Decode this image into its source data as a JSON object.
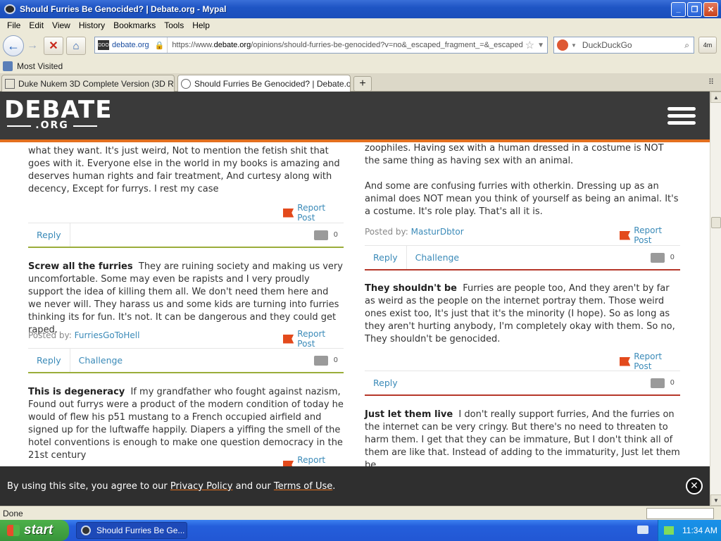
{
  "window": {
    "title": "Should Furries Be Genocided? | Debate.org - Mypal"
  },
  "menu": [
    "File",
    "Edit",
    "View",
    "History",
    "Bookmarks",
    "Tools",
    "Help"
  ],
  "nav": {
    "site_chip": "debate.org",
    "site_fav": "DDO",
    "url_prefix": "https://www.",
    "url_domain": "debate.org",
    "url_rest": "/opinions/should-furries-be-genocided?v=no&_escaped_fragment_=&_escaped_",
    "search_placeholder": "DuckDuckGo",
    "extra_button": "4m"
  },
  "bookmarks": {
    "most_visited": "Most Visited"
  },
  "tabs": [
    {
      "label": "Duke Nukem 3D Complete Version (3D R..."
    },
    {
      "label": "Should Furries Be Genocided? | Debate.org"
    }
  ],
  "site": {
    "logo_main": "DEBATE",
    "logo_sub": ".ORG"
  },
  "left": {
    "p1": "what they want. It's just weird, Not to mention the fetish shit that goes with it. Everyone else in the world in my books is amazing and deserves human rights and fair treatment, And curtesy along with decency, Except for furrys. I rest my case",
    "report1": "Report Post",
    "reply1": "Reply",
    "count1": "0",
    "p2_title": "Screw all the furries",
    "p2_body": "They are ruining society and making us very uncomfortable. Some may even be rapists and I very proudly support the idea of killing them all. We don't need them here and we never will. They harass us and some kids are turning into furries thinking its for fun. It's not. It can be dangerous and they could get raped.",
    "posted_label": "Posted by:",
    "p2_author": "FurriesGoToHell",
    "report2": "Report Post",
    "reply2": "Reply",
    "challenge2": "Challenge",
    "count2": "0",
    "p3_title": "This is degeneracy",
    "p3_body": "If my grandfather who fought against nazism, Found out furrys were a product of the modern condition of today he would of flew his p51 mustang to a French occupied airfield and signed up for the luftwaffe happily. Diapers a yiffing the smell of the hotel conventions is enough to make one question democracy in the 21st century",
    "report3": "Report Post"
  },
  "right": {
    "p1": "zoophiles. Having sex with a human dressed in a costume is NOT the same thing as having sex with an animal.",
    "p1b": "And some are confusing furries with otherkin. Dressing up as an animal does NOT mean you think of yourself as being an animal. It's a costume. It's role play. That's all it is.",
    "posted_label": "Posted by:",
    "author1": "MasturDbtor",
    "report1": "Report Post",
    "reply1": "Reply",
    "challenge1": "Challenge",
    "count1": "0",
    "p2_title": "They shouldn't be",
    "p2_body": "Furries are people too, And they aren't by far as weird as the people on the internet portray them. Those weird ones exist too, It's just that it's the minority (I hope). So as long as they aren't hurting anybody, I'm completely okay with them. So no, They shouldn't be genocided.",
    "report2": "Report Post",
    "reply2": "Reply",
    "count2": "0",
    "p3_title": "Just let them live",
    "p3_body": "I don't really support furries, And the furries on the internet can be very cringy. But there's no need to threaten to harm them. I get that they can be immature, But I don't think all of them are like that. Instead of adding to the immaturity, Just let them be."
  },
  "cookie": {
    "prefix": "By using this site, you agree to our ",
    "privacy": "Privacy Policy",
    "middle": " and our ",
    "terms": "Terms of Use",
    "suffix": "."
  },
  "status": {
    "text": "Done"
  },
  "taskbar": {
    "start": "start",
    "item": "Should Furries Be Ge...",
    "clock": "11:34 AM"
  },
  "colors": {
    "accent": "#e36f1e",
    "link": "#3a8ab8",
    "green_rule": "#9aad3a",
    "red_rule": "#b6372a"
  }
}
